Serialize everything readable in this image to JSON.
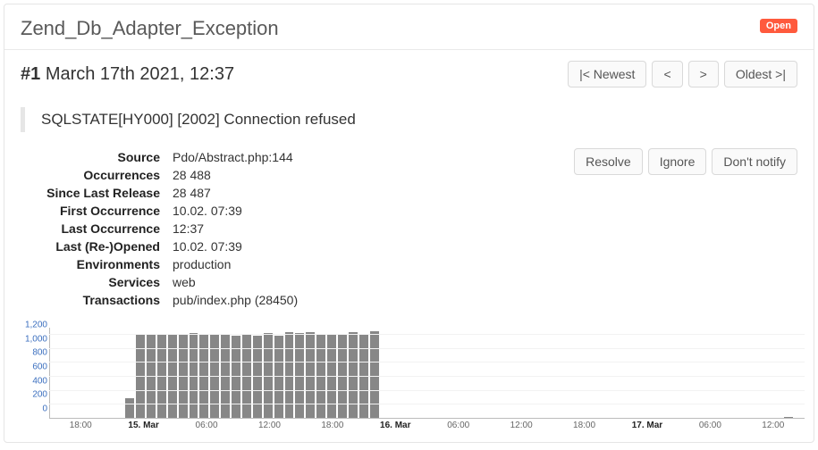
{
  "header": {
    "title": "Zend_Db_Adapter_Exception",
    "status_badge": "Open"
  },
  "occurrence": {
    "number": "#1",
    "datetime": "March 17th 2021, 12:37",
    "nav": {
      "newest": "|< Newest",
      "prev": "<",
      "next": ">",
      "oldest": "Oldest >|"
    }
  },
  "message": "SQLSTATE[HY000] [2002] Connection refused",
  "details": {
    "source_label": "Source",
    "source_value": "Pdo/Abstract.php:144",
    "occurrences_label": "Occurrences",
    "occurrences_value": "28 488",
    "since_last_release_label": "Since Last Release",
    "since_last_release_value": "28 487",
    "first_occurrence_label": "First Occurrence",
    "first_occurrence_value": "10.02. 07:39",
    "last_occurrence_label": "Last Occurrence",
    "last_occurrence_value": "12:37",
    "last_reopened_label": "Last (Re-)Opened",
    "last_reopened_value": "10.02. 07:39",
    "environments_label": "Environments",
    "environments_value": "production",
    "services_label": "Services",
    "services_value": "web",
    "transactions_label": "Transactions",
    "transactions_value": "pub/index.php (28450)"
  },
  "actions": {
    "resolve": "Resolve",
    "ignore": "Ignore",
    "dont_notify": "Don't notify"
  },
  "chart_data": {
    "type": "bar",
    "ylabel": "",
    "xlabel": "",
    "ylim": [
      0,
      1300
    ],
    "yticks": [
      0,
      200,
      400,
      600,
      800,
      1000,
      1200
    ],
    "x_start": "2021-03-14T15:00",
    "x_end": "2021-03-17T14:00",
    "x_ticks": [
      {
        "label": "18:00",
        "major": false
      },
      {
        "label": "15. Mar",
        "major": true
      },
      {
        "label": "06:00",
        "major": false
      },
      {
        "label": "12:00",
        "major": false
      },
      {
        "label": "18:00",
        "major": false
      },
      {
        "label": "16. Mar",
        "major": true
      },
      {
        "label": "06:00",
        "major": false
      },
      {
        "label": "12:00",
        "major": false
      },
      {
        "label": "18:00",
        "major": false
      },
      {
        "label": "17. Mar",
        "major": true
      },
      {
        "label": "06:00",
        "major": false
      },
      {
        "label": "12:00",
        "major": false
      }
    ],
    "categories_hours_since_start": [
      0,
      1,
      2,
      3,
      4,
      5,
      6,
      7,
      8,
      9,
      10,
      11,
      12,
      13,
      14,
      15,
      16,
      17,
      18,
      19,
      20,
      21,
      22,
      23,
      24,
      25,
      26,
      27,
      28,
      29,
      30,
      31,
      32,
      33,
      34,
      35,
      36,
      37,
      38,
      39,
      40,
      41,
      42,
      43,
      44,
      45,
      46,
      47,
      48,
      49,
      50,
      51,
      52,
      53,
      54,
      55,
      56,
      57,
      58,
      59,
      60,
      61,
      62,
      63,
      64,
      65,
      66,
      67,
      68,
      69,
      70
    ],
    "values": [
      0,
      0,
      0,
      0,
      0,
      0,
      0,
      280,
      1200,
      1200,
      1210,
      1200,
      1200,
      1225,
      1200,
      1210,
      1210,
      1180,
      1215,
      1190,
      1225,
      1190,
      1230,
      1220,
      1240,
      1205,
      1210,
      1215,
      1235,
      1210,
      1250,
      0,
      0,
      0,
      0,
      0,
      0,
      0,
      0,
      0,
      0,
      0,
      0,
      0,
      0,
      0,
      0,
      0,
      0,
      0,
      0,
      0,
      0,
      0,
      0,
      0,
      0,
      0,
      0,
      0,
      0,
      0,
      0,
      0,
      0,
      0,
      0,
      0,
      0,
      10,
      0
    ]
  }
}
